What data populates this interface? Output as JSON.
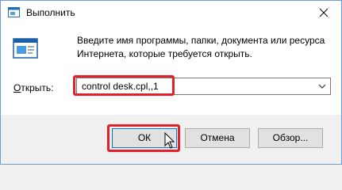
{
  "window": {
    "title": "Выполнить",
    "close_glyph": "✕"
  },
  "dialog": {
    "description": "Введите имя программы, папки, документа или ресурса\nИнтернета, которые требуется открыть.",
    "open_label_access_key": "О",
    "open_label_rest": "ткрыть:",
    "command_value": "control desk.cpl,,1"
  },
  "buttons": {
    "ok": "ОК",
    "cancel": "Отмена",
    "browse": "Обзор..."
  },
  "colors": {
    "highlight": "#e3202a",
    "accent": "#0078d7"
  },
  "icons": {
    "app": "run-dialog-icon",
    "close": "close-icon",
    "dropdown": "chevron-down-icon",
    "cursor": "mouse-pointer-icon"
  }
}
